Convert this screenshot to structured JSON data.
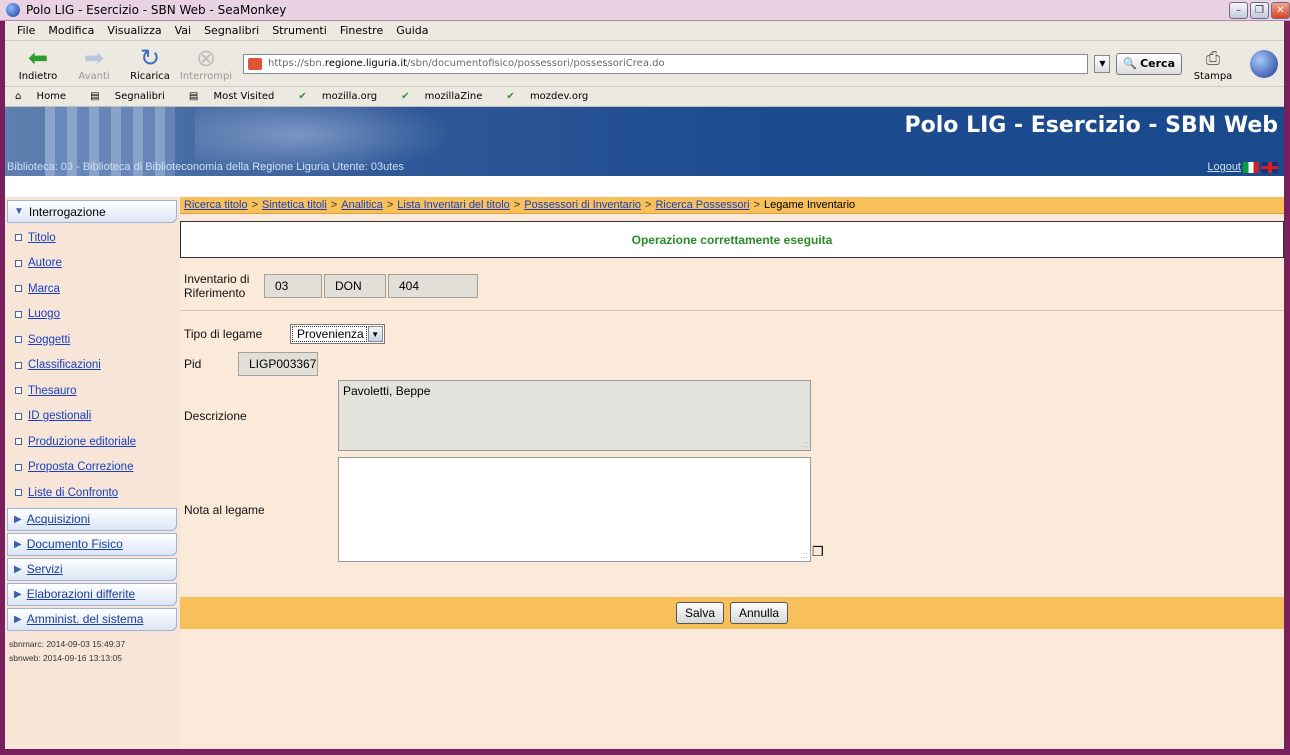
{
  "window": {
    "title": "Polo LIG - Esercizio - SBN Web - SeaMonkey"
  },
  "menu": [
    "File",
    "Modifica",
    "Visualizza",
    "Vai",
    "Segnalibri",
    "Strumenti",
    "Finestre",
    "Guida"
  ],
  "nav": {
    "back": "Indietro",
    "forward": "Avanti",
    "reload": "Ricarica",
    "stop": "Interrompi",
    "url_prefix": "https://sbn.",
    "url_host": "regione.liguria.it",
    "url_path": "/sbn/documentofisico/possessori/possessoriCrea.do",
    "search": "Cerca",
    "print": "Stampa"
  },
  "bookmarks": [
    "Home",
    "Segnalibri",
    "Most Visited",
    "mozilla.org",
    "mozillaZine",
    "mozdev.org"
  ],
  "banner": {
    "title": "Polo LIG - Esercizio - SBN Web",
    "info": "Biblioteca: 03 - Biblioteca di Biblioteconomia della Regione Liguria  Utente: 03utes",
    "logout": "Logout"
  },
  "sidebar": {
    "interrogazione": "Interrogazione",
    "items": [
      "Titolo",
      "Autore",
      "Marca",
      "Luogo",
      "Soggetti",
      "Classificazioni",
      "Thesauro",
      "ID gestionali",
      "Produzione editoriale",
      "Proposta Correzione",
      "Liste di Confronto"
    ],
    "sections": [
      "Acquisizioni",
      "Documento Fisico",
      "Servizi",
      "Elaborazioni differite",
      "Amminist. del sistema"
    ],
    "meta1": "sbnmarc:  2014-09-03 15:49:37",
    "meta2": "sbnweb:  2014-09-16 13:13:05"
  },
  "breadcrumb": {
    "links": [
      "Ricerca titolo",
      "Sintetica titoli",
      "Analitica",
      "Lista Inventari del titolo",
      "Possessori di Inventario",
      "Ricerca Possessori"
    ],
    "current": "Legame Inventario"
  },
  "message": "Operazione correttamente eseguita",
  "form": {
    "inventario_label1": "Inventario di",
    "inventario_label2": "Riferimento",
    "inv_bib": "03",
    "inv_serie": "DON",
    "inv_num": "404",
    "tipo_label": "Tipo di legame",
    "tipo_value": "Provenienza",
    "pid_label": "Pid",
    "pid_value": "LIGP003367",
    "descr_label": "Descrizione",
    "descr_value": "Pavoletti, Beppe",
    "nota_label": "Nota al legame",
    "nota_value": ""
  },
  "buttons": {
    "save": "Salva",
    "cancel": "Annulla"
  }
}
